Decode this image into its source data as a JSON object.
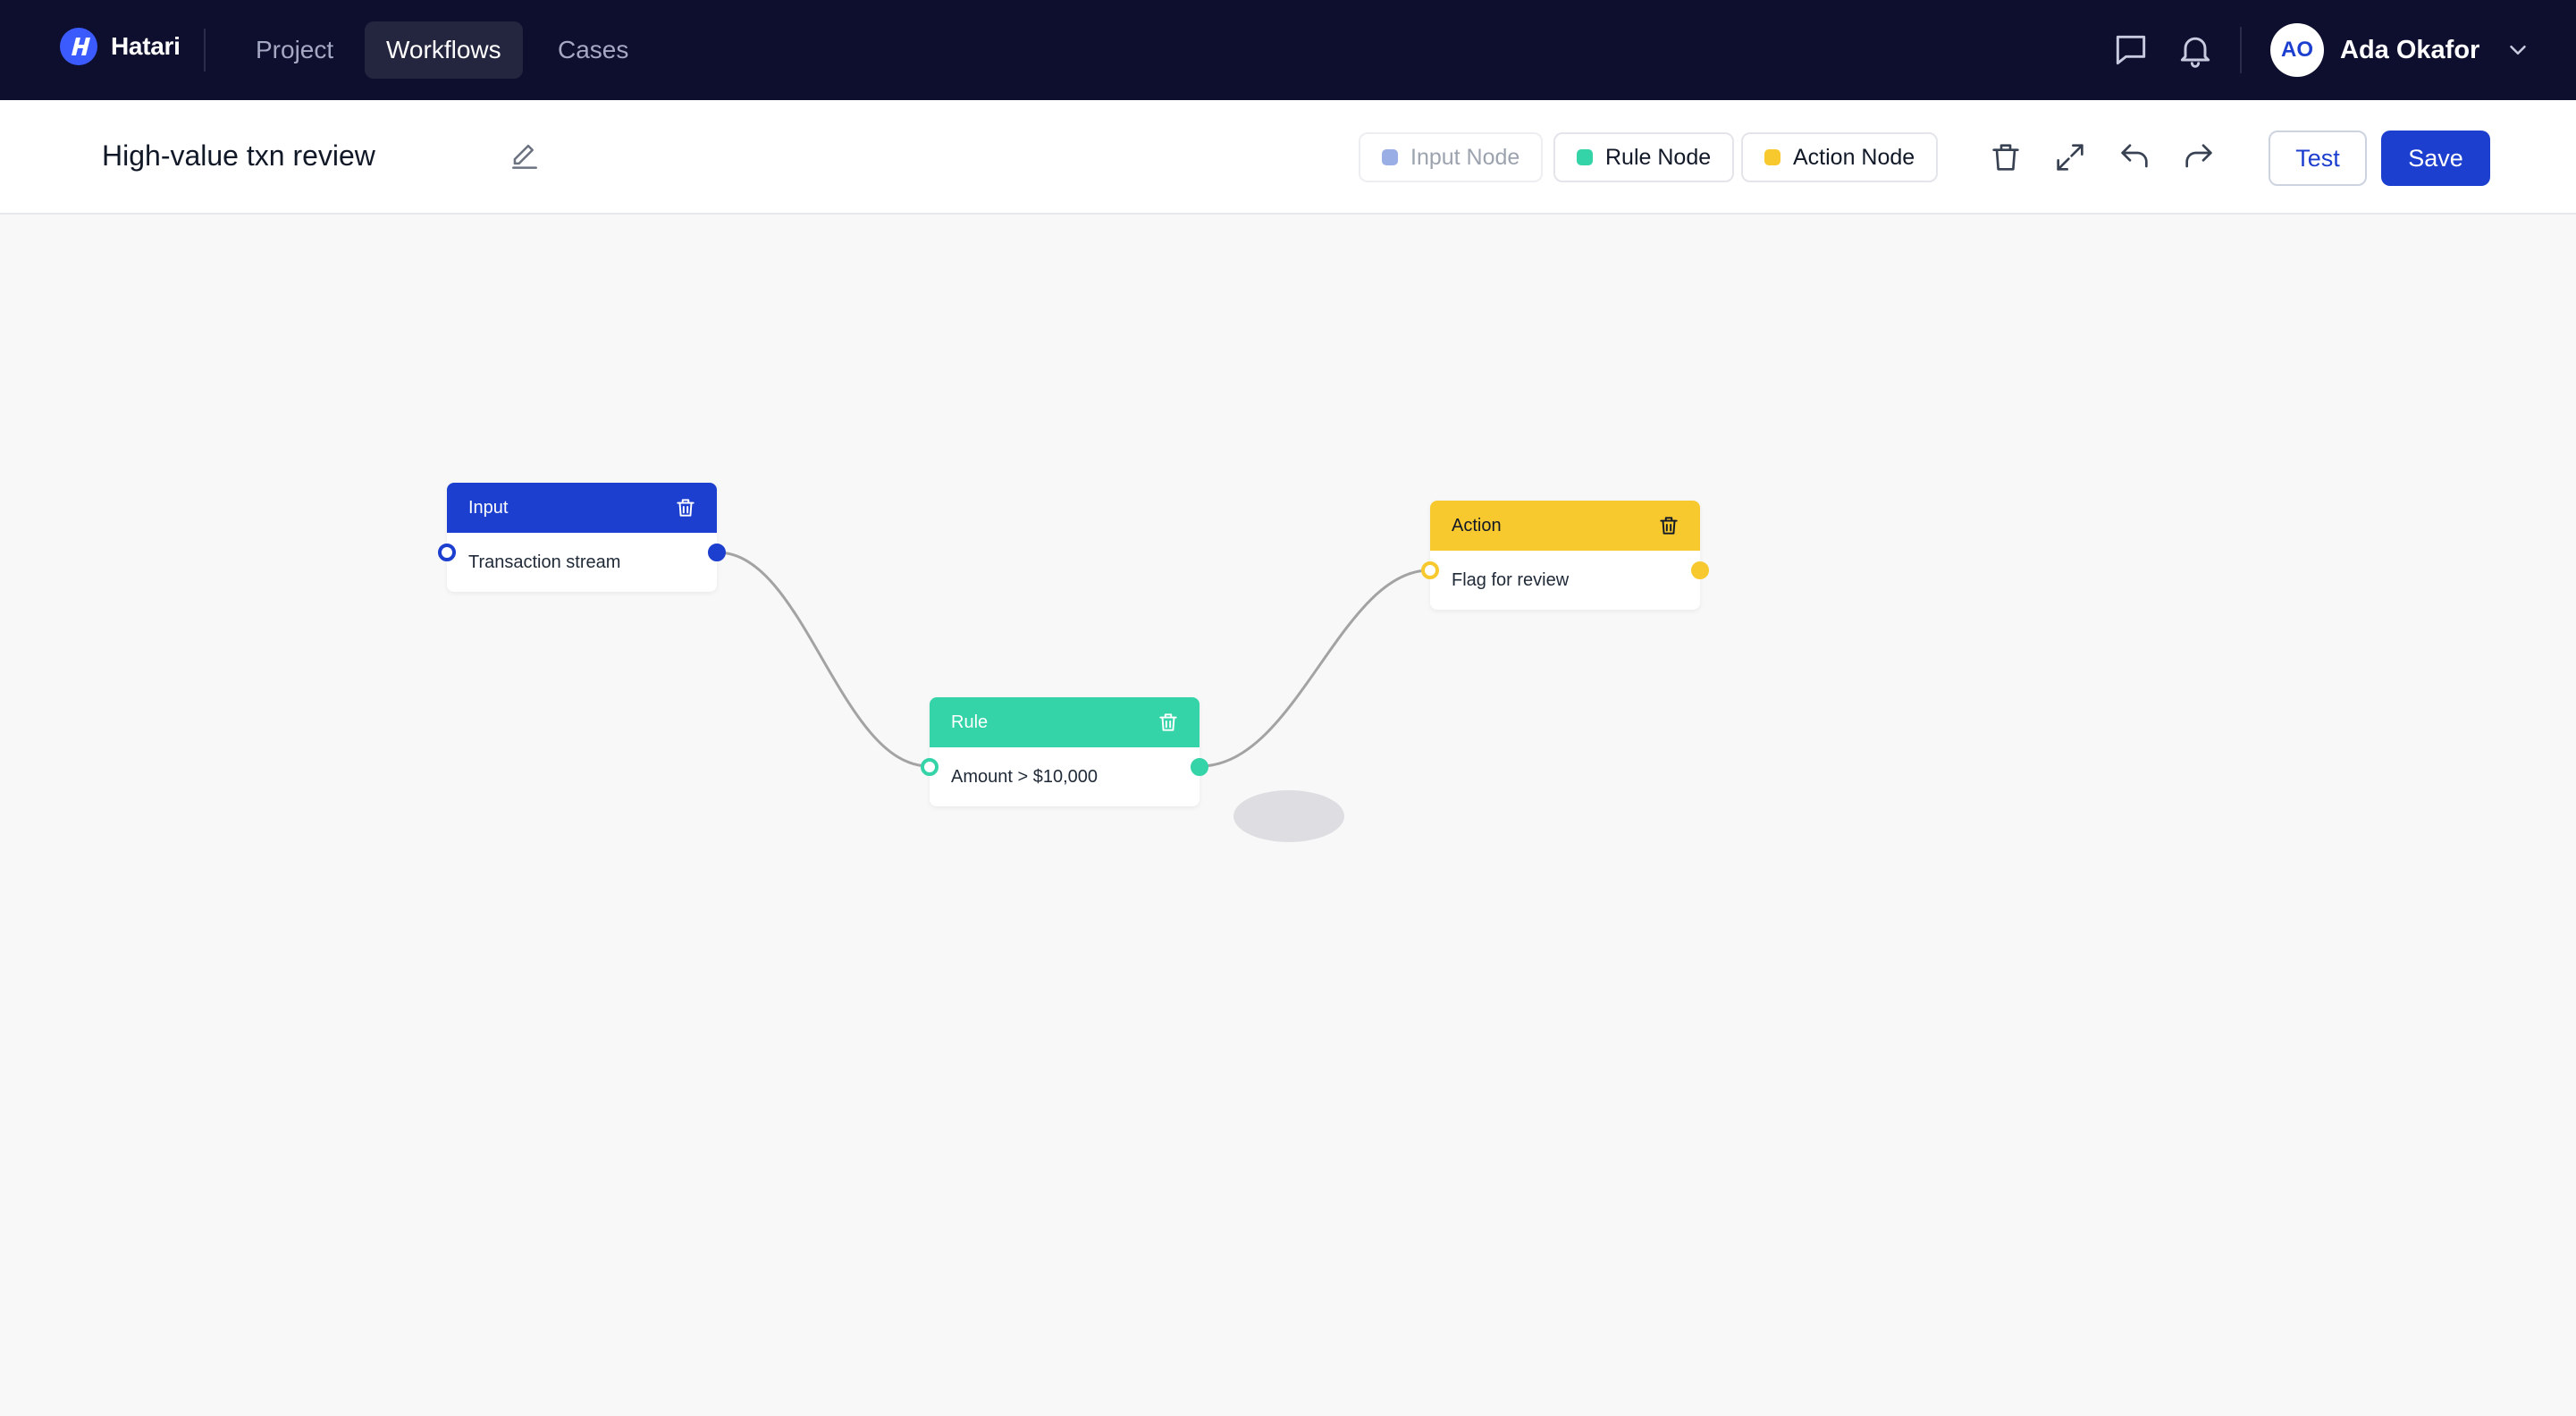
{
  "app": {
    "brand": "Hatari"
  },
  "nav": {
    "items": [
      {
        "label": "Project",
        "active": false
      },
      {
        "label": "Workflows",
        "active": true
      },
      {
        "label": "Cases",
        "active": false
      }
    ],
    "icons": [
      "chat-icon",
      "bell-icon"
    ]
  },
  "user": {
    "initials": "AO",
    "name": "Ada Okafor"
  },
  "toolbar": {
    "workflow_title": "High-value txn review",
    "palette": [
      {
        "label": "Input Node",
        "color": "#9aaee6",
        "enabled": false
      },
      {
        "label": "Rule Node",
        "color": "#34d3a8",
        "enabled": true
      },
      {
        "label": "Action Node",
        "color": "#f7c92f",
        "enabled": true
      }
    ],
    "tools": [
      "trash-icon",
      "expand-icon",
      "undo-icon",
      "redo-icon"
    ],
    "test_label": "Test",
    "save_label": "Save"
  },
  "nodes": {
    "input": {
      "title": "Input",
      "content": "Transaction stream",
      "color": "#1d3fcf"
    },
    "rule": {
      "title": "Rule",
      "content": "Amount > $10,000",
      "color": "#34d3a8"
    },
    "action": {
      "title": "Action",
      "content": "Flag for review",
      "color": "#f7c92f"
    }
  },
  "colors": {
    "nav_bg": "#0e0f2e",
    "accent": "#1d3fcf",
    "canvas_bg": "#f8f8f8",
    "edge": "#a3a3a3"
  }
}
